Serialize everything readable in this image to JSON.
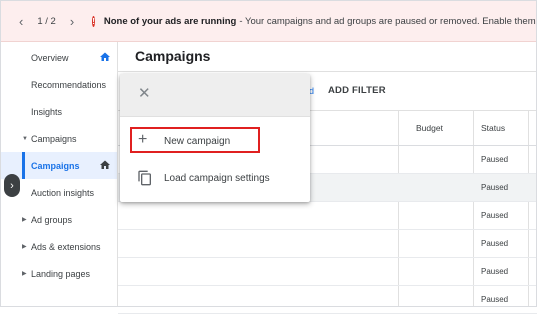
{
  "banner": {
    "prev_icon": "chevron-left-icon",
    "next_icon": "chevron-right-icon",
    "pager_text": "1 / 2",
    "alert_icon": "error-icon",
    "alert_title": "None of your ads are running",
    "alert_message": " - Your campaigns and ad groups are paused or removed. Enable them to begi"
  },
  "sidebar": {
    "items": [
      {
        "label": "Overview",
        "icon": "home-icon"
      },
      {
        "label": "Recommendations"
      },
      {
        "label": "Insights"
      },
      {
        "label": "Campaigns",
        "expanded": true
      },
      {
        "label": "Campaigns",
        "icon": "home-icon",
        "active": true
      },
      {
        "label": "Auction insights"
      },
      {
        "label": "Ad groups",
        "collapsed": true
      },
      {
        "label": "Ads & extensions",
        "collapsed": true
      },
      {
        "label": "Landing pages",
        "collapsed": true
      }
    ],
    "collapse_icon": "chevron-right-icon"
  },
  "main": {
    "title": "Campaigns",
    "filter_fragment": "d",
    "add_filter": "ADD FILTER",
    "columns": {
      "budget": "Budget",
      "status": "Status"
    },
    "rows": [
      {
        "status": "Paused"
      },
      {
        "status": "Paused"
      },
      {
        "status": "Paused"
      },
      {
        "status": "Paused"
      },
      {
        "status": "Paused"
      },
      {
        "status": "Paused"
      }
    ]
  },
  "menu": {
    "close_icon": "close-icon",
    "items": [
      {
        "label": "New campaign",
        "icon": "plus-icon",
        "highlighted": true
      },
      {
        "label": "Load campaign settings",
        "icon": "copy-icon"
      }
    ]
  },
  "colors": {
    "accent": "#1a73e8",
    "error": "#d93025",
    "highlight": "#e02020",
    "banner_bg": "#fdeeee"
  }
}
